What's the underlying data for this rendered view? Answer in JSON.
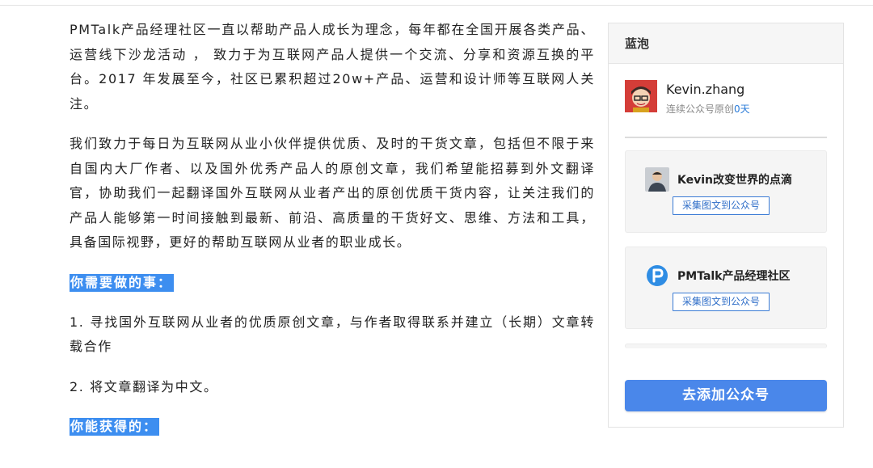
{
  "article": {
    "p1": "PMTalk产品经理社区一直以帮助产品人成长为理念，每年都在全国开展各类产品、运营线下沙龙活动 ， 致力于为互联网产品人提供一个交流、分享和资源互换的平台。2017 年发展至今，社区已累积超过20w+产品、运营和设计师等互联网人关注。",
    "p2": "我们致力于每日为互联网从业小伙伴提供优质、及时的干货文章，包括但不限于来自国内大厂作者、以及国外优秀产品人的原创文章，我们希望能招募到外文翻译官，协助我们一起翻译国外互联网从业者产出的原创优质干货内容，让关注我们的产品人能够第一时间接触到最新、前沿、高质量的干货好文、思维、方法和工具，具备国际视野，更好的帮助互联网从业者的职业成长。",
    "h1": "你需要做的事：",
    "item1": "1. 寻找国外互联网从业者的优质原创文章，与作者取得联系并建立（长期）文章转载合作",
    "item2": "2. 将文章翻译为中文。",
    "h2": "你能获得的："
  },
  "sidebar": {
    "title": "蓝泡",
    "user": {
      "name": "Kevin.zhang",
      "streak_prefix": "连续公众号原创",
      "streak_days": "0天"
    },
    "accounts": [
      {
        "name": "Kevin改变世界的点滴",
        "button": "采集图文到公众号",
        "logo": "person-avatar"
      },
      {
        "name": "PMTalk产品经理社区",
        "button": "采集图文到公众号",
        "logo": "pmtalk-logo"
      }
    ],
    "add_button": "去添加公众号"
  },
  "colors": {
    "highlight": "#3d8ef0",
    "primary_button": "#4a87ea",
    "link_blue": "#2a7bd8"
  }
}
